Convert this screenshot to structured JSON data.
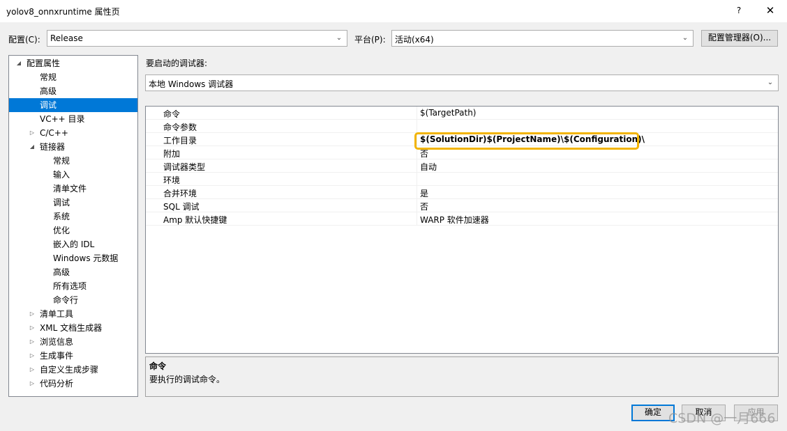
{
  "window": {
    "title": "yolov8_onnxruntime 属性页",
    "help": "?",
    "close": "✕"
  },
  "toolbar": {
    "config_label": "配置(C):",
    "config_value": "Release",
    "platform_label": "平台(P):",
    "platform_value": "活动(x64)",
    "config_manager": "配置管理器(O)..."
  },
  "tree": {
    "items": [
      {
        "label": "配置属性",
        "expander": "◢"
      },
      {
        "label": "常规"
      },
      {
        "label": "高级"
      },
      {
        "label": "调试",
        "selected": true
      },
      {
        "label": "VC++ 目录"
      },
      {
        "label": "C/C++",
        "expander": "▷"
      },
      {
        "label": "链接器",
        "expander": "◢"
      },
      {
        "label": "常规"
      },
      {
        "label": "输入"
      },
      {
        "label": "清单文件"
      },
      {
        "label": "调试"
      },
      {
        "label": "系统"
      },
      {
        "label": "优化"
      },
      {
        "label": "嵌入的 IDL"
      },
      {
        "label": "Windows 元数据"
      },
      {
        "label": "高级"
      },
      {
        "label": "所有选项"
      },
      {
        "label": "命令行"
      },
      {
        "label": "清单工具",
        "expander": "▷"
      },
      {
        "label": "XML 文档生成器",
        "expander": "▷"
      },
      {
        "label": "浏览信息",
        "expander": "▷"
      },
      {
        "label": "生成事件",
        "expander": "▷"
      },
      {
        "label": "自定义生成步骤",
        "expander": "▷"
      },
      {
        "label": "代码分析",
        "expander": "▷"
      }
    ]
  },
  "debugger": {
    "label": "要启动的调试器:",
    "value": "本地 Windows 调试器"
  },
  "grid": {
    "rows": [
      {
        "name": "命令",
        "value": "$(TargetPath)"
      },
      {
        "name": "命令参数",
        "value": ""
      },
      {
        "name": "工作目录",
        "value": "$(SolutionDir)$(ProjectName)\\$(Configuration)\\"
      },
      {
        "name": "附加",
        "value": "否"
      },
      {
        "name": "调试器类型",
        "value": "自动"
      },
      {
        "name": "环境",
        "value": ""
      },
      {
        "name": "合并环境",
        "value": "是"
      },
      {
        "name": "SQL 调试",
        "value": "否"
      },
      {
        "name": "Amp 默认快捷键",
        "value": "WARP 软件加速器"
      }
    ]
  },
  "description": {
    "title": "命令",
    "text": "要执行的调试命令。"
  },
  "buttons": {
    "ok": "确定",
    "cancel": "取消",
    "apply": "应用"
  },
  "watermark": "CSDN @一月666",
  "colors": {
    "selection": "#0078d7",
    "highlight_border": "#f2b400"
  }
}
